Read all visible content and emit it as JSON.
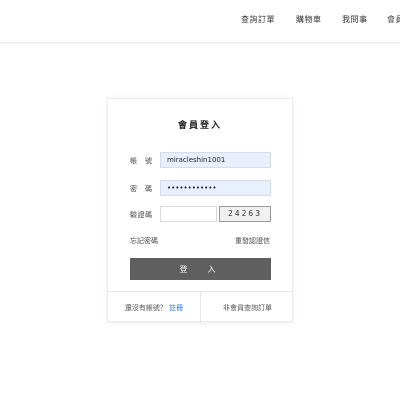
{
  "nav": {
    "items": [
      "查詢訂單",
      "購物車",
      "我問事",
      "會員"
    ]
  },
  "login": {
    "title": "會員登入",
    "account_label": "帳　號",
    "account_value": "miracleshin1001",
    "password_label": "密　碼",
    "password_value": "••••••••••••",
    "captcha_label": "驗證碼",
    "captcha_value": "",
    "captcha_code": "24263",
    "forgot_password": "忘記密碼",
    "resend_verification": "重發認證信",
    "login_button": "登　入",
    "no_account_text": "還沒有帳號？",
    "join_link": "註冊",
    "non_member_order": "非會員查詢訂單"
  },
  "colors": {
    "input_autofill_bg": "#e8f0fe",
    "login_button_bg": "#5f5f5f",
    "join_link": "#2a6fd6"
  }
}
